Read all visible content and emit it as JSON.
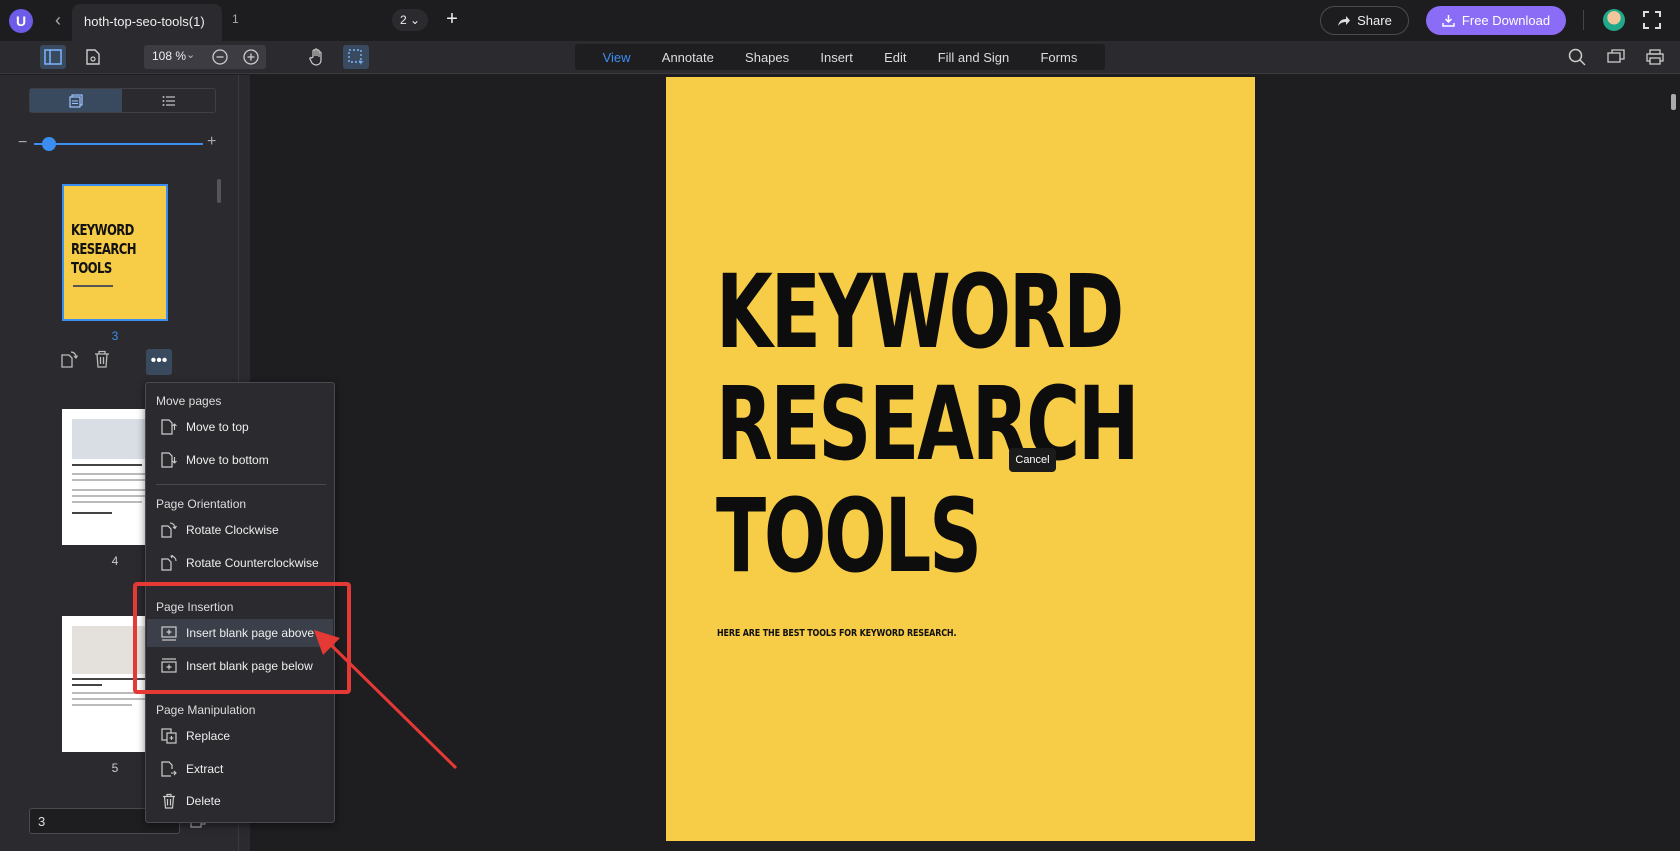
{
  "app": {
    "logo_letter": "U",
    "tab_title": "hoth-top-seo-tools(1)",
    "second_tab_label": "1",
    "tab_count": "2",
    "share_label": "Share",
    "download_label": "Free Download"
  },
  "toolbar": {
    "zoom": "108 %",
    "modes": [
      "View",
      "Annotate",
      "Shapes",
      "Insert",
      "Edit",
      "Fill and Sign",
      "Forms"
    ],
    "active_mode": "View"
  },
  "sidebar": {
    "thumbnails": [
      {
        "page": "3",
        "title_lines": "KEYWORD\nRESEARCH\nTOOLS",
        "selected": true
      },
      {
        "page": "4",
        "heading": "Spy On Competitors With SEMRush"
      },
      {
        "page": "5",
        "heading": "Get Fast Keyword Suggestions With KWFinder"
      }
    ],
    "page_input_value": "3"
  },
  "context_menu": {
    "sections": [
      {
        "heading": "Move pages",
        "items": [
          "Move to top",
          "Move to bottom"
        ]
      },
      {
        "heading": "Page Orientation",
        "items": [
          "Rotate Clockwise",
          "Rotate Counterclockwise"
        ]
      },
      {
        "heading": "Page Insertion",
        "items": [
          "Insert blank page above",
          "Insert blank page below"
        ]
      },
      {
        "heading": "Page Manipulation",
        "items": [
          "Replace",
          "Extract",
          "Delete"
        ]
      }
    ],
    "hovered_item": "Insert blank page above"
  },
  "document": {
    "title": "KEYWORD\nRESEARCH\nTOOLS",
    "subtitle": "HERE ARE THE BEST TOOLS FOR KEYWORD RESEARCH.",
    "tooltip": "Cancel"
  },
  "colors": {
    "accent": "#3b8ef0",
    "download": "#8b6cf6",
    "page_bg": "#f7cc47",
    "highlight": "#e53935"
  }
}
